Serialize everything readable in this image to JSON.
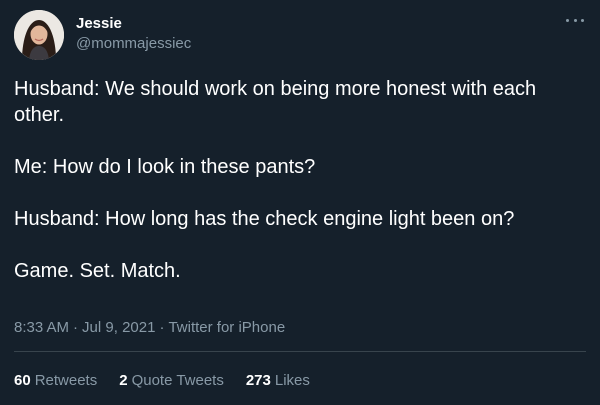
{
  "author": {
    "display_name": "Jessie",
    "handle": "@mommajessiec"
  },
  "tweet": {
    "paragraphs": [
      "Husband: We should work on being more honest with each other.",
      "Me: How do I look in these pants?",
      "Husband: How long has the check engine light been on?",
      "Game. Set. Match."
    ]
  },
  "meta": {
    "time": "8:33 AM",
    "separator": "·",
    "date": "Jul 9, 2021",
    "source": "Twitter for iPhone"
  },
  "stats": {
    "retweets_count": "60",
    "retweets_label": "Retweets",
    "quotes_count": "2",
    "quotes_label": "Quote Tweets",
    "likes_count": "273",
    "likes_label": "Likes"
  },
  "icons": {
    "more": "more-horizontal-icon"
  },
  "colors": {
    "background": "#15202b",
    "text_primary": "#ffffff",
    "text_secondary": "#8899a6",
    "divider": "#38444d"
  }
}
